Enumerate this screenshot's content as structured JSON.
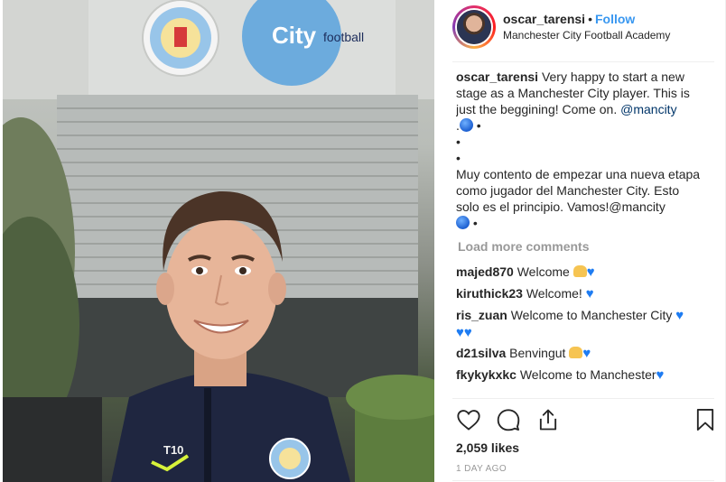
{
  "post": {
    "username": "oscar_tarensi",
    "separator": "•",
    "follow_label": "Follow",
    "location": "Manchester City Football Academy",
    "photo": {
      "jersey_number": "T10",
      "crest_text": "MANCHESTER CITY",
      "sign_text": "City",
      "sign_sub": "football"
    }
  },
  "caption": {
    "user": "oscar_tarensi",
    "text_en": "Very happy to start a new stage as a Manchester City player. This is just the beggining! Come on.",
    "mention": "@mancity",
    "line1": ".",
    "bullet": "•",
    "text_es": "Muy contento de empezar una nueva etapa como jugador del Manchester City. Esto solo es el principio. Vamos!@mancity"
  },
  "load_more": "Load more comments",
  "comments": [
    {
      "user": "majed870",
      "text": "Welcome"
    },
    {
      "user": "kiruthick23",
      "text": "Welcome!"
    },
    {
      "user": "ris_zuan",
      "text": "Welcome to Manchester City"
    },
    {
      "user": "d21silva",
      "text": "Benvingut"
    },
    {
      "user": "fkykykxkc",
      "text": "Welcome to Manchester"
    },
    {
      "user": "",
      "text": ""
    }
  ],
  "stats": {
    "likes": "2,059 likes",
    "time": "1 DAY AGO"
  },
  "icons": {
    "like": "heart-outline-icon",
    "comment": "comment-bubble-icon",
    "share": "share-icon",
    "save": "bookmark-icon"
  },
  "colors": {
    "follow_blue": "#3897f0",
    "mention_blue": "#003569",
    "muted_gray": "#999999",
    "city_blue": "#6cabdd"
  }
}
